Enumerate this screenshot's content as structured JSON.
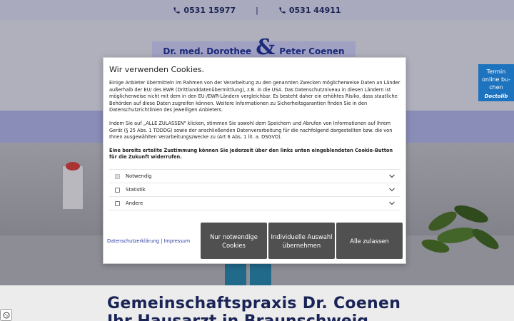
{
  "topbar": {
    "phone1": "0531 15977",
    "separator": "|",
    "phone2": "0531 44911"
  },
  "logo": {
    "left": "Dr. med. Dorothee",
    "amp": "&",
    "right": "Peter Coenen"
  },
  "page": {
    "heading_line1": "Gemeinschaftspraxis Dr. Coenen",
    "heading_line2": "Ihr Hausarzt in Braunschweig"
  },
  "booking": {
    "line1": "Termin",
    "line2": "online bu-",
    "line3": "chen",
    "brand": "Doctolib"
  },
  "cookie": {
    "title": "Wir verwenden Cookies.",
    "para1": "Einige Anbieter übermitteln im Rahmen von der Verarbeitung zu den genannten Zwecken möglicherweise Daten an Länder außerhalb der EU/ des EWR (Drittlanddatenübermittlung), z.B. in die USA. Das Datenschutzniveau in diesen Ländern ist möglicherweise nicht mit dem in den EU-/EWR-Ländern vergleichbar. Es besteht daher ein erhöhtes Risiko, dass staatliche Behörden auf diese Daten zugreifen können. Weitere Informationen zu Sicherheitsgarantien finden Sie in den Datenschutzrichtlinien des jeweiligen Anbieters.",
    "para2": "Indem Sie auf „ALLE ZULASSEN\" klicken, stimmen Sie sowohl dem Speichern und Abrufen von Informationen auf Ihrem Gerät (§ 25 Abs. 1 TDDDG) sowie der anschließenden Datenverarbeitung für die nachfolgend dargestellten bzw. die von Ihnen ausgewählten Verarbeitungszwecke zu (Art 6 Abs. 1 lit. a. DSGVO).",
    "para3": "Eine bereits erteilte Zustimmung können Sie jederzeit über den links unten eingeblendeten Cookie-Button für die Zukunft widerrufen.",
    "options": [
      {
        "label": "Notwendig",
        "checked": true
      },
      {
        "label": "Statistik",
        "checked": false
      },
      {
        "label": "Andere",
        "checked": false
      }
    ],
    "link_privacy": "Datenschutzerklärung",
    "link_sep": "|",
    "link_imprint": "Impressum",
    "btn_necessary": "Nur notwendige Cookies",
    "btn_individual": "Individuelle Auswahl übernehmen",
    "btn_all": "Alle zulassen"
  },
  "colors": {
    "brand_navy": "#1b2a7a",
    "button_gray": "#505050",
    "doctolib_blue": "#1e73be"
  }
}
